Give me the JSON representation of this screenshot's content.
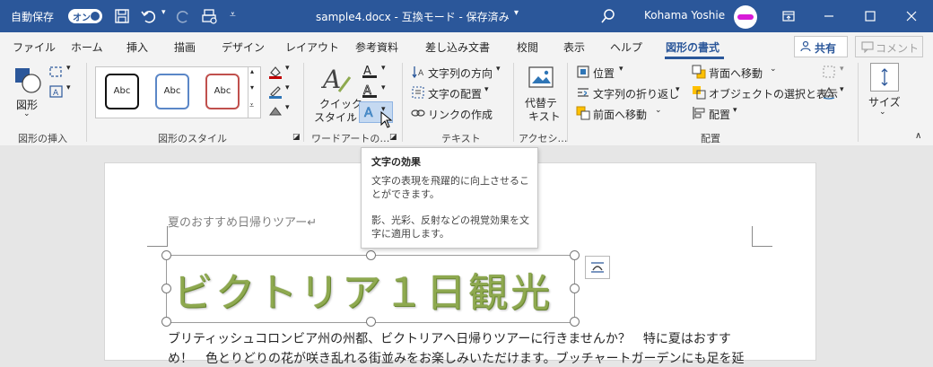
{
  "title_bar": {
    "autosave_label": "自動保存",
    "autosave_state": "オン",
    "doc_title": "sample4.docx - 互換モード - 保存済み",
    "user_name": "Kohama Yoshie",
    "accent_color": "#2b579a"
  },
  "tabs": [
    "ファイル",
    "ホーム",
    "挿入",
    "描画",
    "デザイン",
    "レイアウト",
    "参考資料",
    "差し込み文書",
    "校閲",
    "表示",
    "ヘルプ",
    "図形の書式"
  ],
  "active_tab": "図形の書式",
  "share_label": "共有",
  "comment_label": "コメント",
  "ribbon": {
    "insert_shapes": {
      "shape_label": "図形",
      "group": "図形の挿入"
    },
    "shape_styles": {
      "gallery": [
        "Abc",
        "Abc",
        "Abc"
      ],
      "group": "図形のスタイル"
    },
    "wordart": {
      "quick_style_line1": "クイック",
      "quick_style_line2": "スタイル",
      "group": "ワードアートの…"
    },
    "text": {
      "direction": "文字列の方向",
      "align": "文字の配置",
      "link": "リンクの作成",
      "group": "テキスト"
    },
    "accessibility": {
      "alt_line1": "代替テ",
      "alt_line2": "キスト",
      "group": "アクセシ…"
    },
    "arrange": {
      "position": "位置",
      "wrap": "文字列の折り返し",
      "forward": "前面へ移動",
      "backward": "背面へ移動",
      "selection": "オブジェクトの選択と表示",
      "align": "配置",
      "group": "配置"
    },
    "size": {
      "label": "サイズ"
    }
  },
  "tooltip": {
    "title": "文字の効果",
    "desc1": "文字の表現を飛躍的に向上させるこ",
    "desc2": "とができます。",
    "desc3": "影、光彩、反射などの視覚効果を文",
    "desc4": "字に適用します。"
  },
  "document": {
    "heading": "夏のおすすめ日帰りツアー↵",
    "wordart_text": "ビクトリア１日観光",
    "wordart_color": "#8ea94f",
    "body_line1": "ブリティッシュコロンビア州の州都、ビクトリアへ日帰りツアーに行きませんか？　特に夏はおすす",
    "body_line2": "め！　色とりどりの花が咲き乱れる街並みをお楽しみいただけます。ブッチャートガーデンにも足を延"
  }
}
